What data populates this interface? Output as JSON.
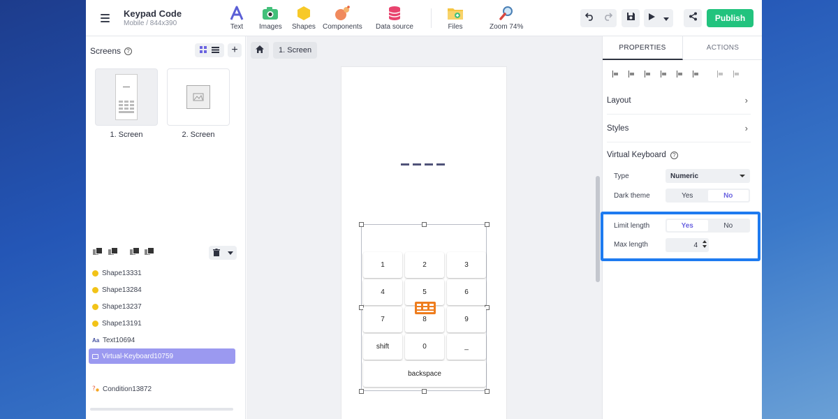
{
  "project": {
    "title": "Keypad Code",
    "subtitle": "Mobile / 844x390"
  },
  "toolbar": {
    "text": "Text",
    "images": "Images",
    "shapes": "Shapes",
    "components": "Components",
    "data_source": "Data source",
    "files": "Files",
    "zoom": "Zoom 74%",
    "publish": "Publish"
  },
  "screens_panel": {
    "title": "Screens",
    "screens": [
      {
        "label": "1. Screen"
      },
      {
        "label": "2. Screen"
      }
    ]
  },
  "layers": [
    {
      "label": "Shape13331",
      "icon": "shape-icon"
    },
    {
      "label": "Shape13284",
      "icon": "shape-icon"
    },
    {
      "label": "Shape13237",
      "icon": "shape-icon"
    },
    {
      "label": "Shape13191",
      "icon": "shape-icon"
    },
    {
      "label": "Text10694",
      "icon": "text-icon"
    },
    {
      "label": "Virtual-Keyboard10759",
      "icon": "keyboard-icon",
      "selected": true
    },
    {
      "label": "Condition13872",
      "icon": "condition-icon"
    }
  ],
  "canvas": {
    "breadcrumb": "1. Screen",
    "keys": [
      "1",
      "2",
      "3",
      "4",
      "5",
      "6",
      "7",
      "8",
      "9",
      "shift",
      "0",
      "_",
      "backspace"
    ]
  },
  "properties": {
    "tabs": {
      "properties": "PROPERTIES",
      "actions": "ACTIONS"
    },
    "sections": {
      "layout": "Layout",
      "styles": "Styles"
    },
    "virtual_keyboard": {
      "title": "Virtual Keyboard",
      "type_label": "Type",
      "type_value": "Numeric",
      "dark_theme_label": "Dark theme",
      "dark_theme_yes": "Yes",
      "dark_theme_no": "No",
      "limit_length_label": "Limit length",
      "limit_length_yes": "Yes",
      "limit_length_no": "No",
      "max_length_label": "Max length",
      "max_length_value": "4"
    }
  },
  "colors": {
    "accent": "#22c37e",
    "selection": "#9b99f0",
    "highlight": "#1e7bf0",
    "toggle_on_text": "#6a63e0"
  }
}
